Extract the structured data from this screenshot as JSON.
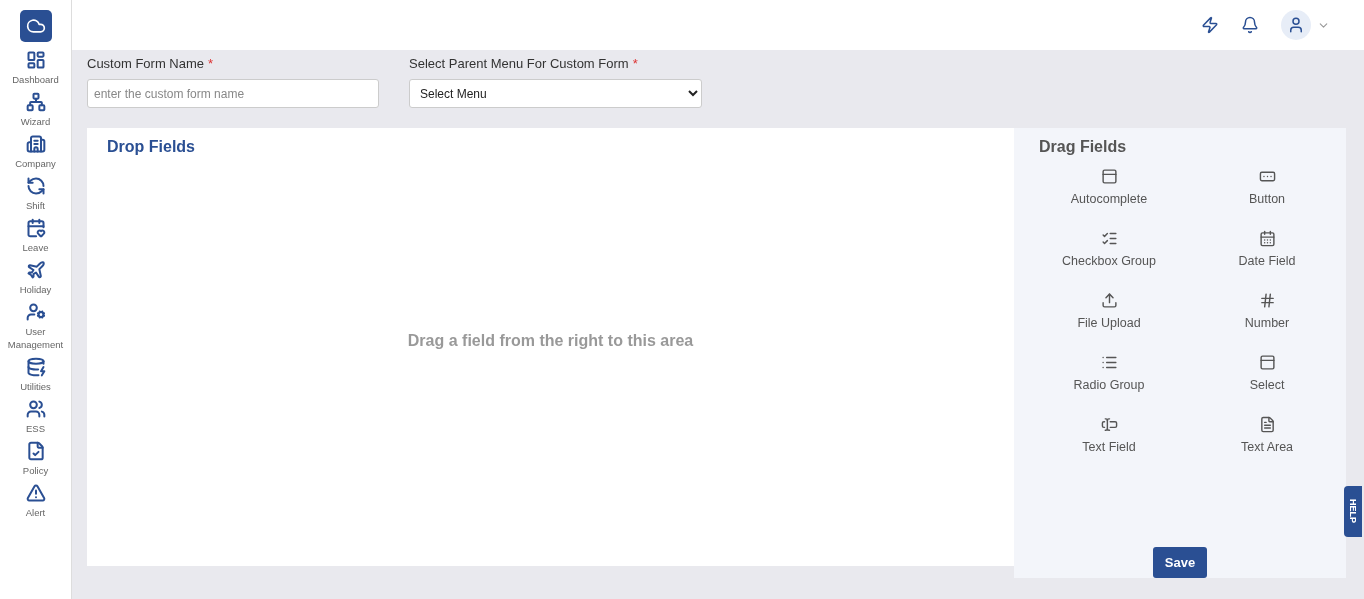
{
  "sidebar": {
    "items": [
      {
        "kind": "dashboard",
        "label": "Dashboard"
      },
      {
        "kind": "wizard",
        "label": "Wizard"
      },
      {
        "kind": "company",
        "label": "Company"
      },
      {
        "kind": "shift",
        "label": "Shift"
      },
      {
        "kind": "leave",
        "label": "Leave"
      },
      {
        "kind": "holiday",
        "label": "Holiday"
      },
      {
        "kind": "user",
        "label": "User Management"
      },
      {
        "kind": "utilities",
        "label": "Utilities"
      },
      {
        "kind": "ess",
        "label": "ESS"
      },
      {
        "kind": "policy",
        "label": "Policy"
      },
      {
        "kind": "alert",
        "label": "Alert"
      }
    ]
  },
  "form": {
    "name_label": "Custom Form Name",
    "name_required": "*",
    "name_placeholder": "enter the custom form name",
    "menu_label": "Select Parent Menu For Custom Form",
    "menu_required": "*",
    "menu_value": "Select Menu"
  },
  "drop_area": {
    "title": "Drop Fields",
    "hint": "Drag a field from the right to this area"
  },
  "drag_area": {
    "title": "Drag Fields",
    "fields": [
      {
        "kind": "autocomplete",
        "label": "Autocomplete"
      },
      {
        "kind": "button",
        "label": "Button"
      },
      {
        "kind": "checkbox",
        "label": "Checkbox Group"
      },
      {
        "kind": "date",
        "label": "Date Field"
      },
      {
        "kind": "upload",
        "label": "File Upload"
      },
      {
        "kind": "number",
        "label": "Number"
      },
      {
        "kind": "radio",
        "label": "Radio Group"
      },
      {
        "kind": "select",
        "label": "Select"
      },
      {
        "kind": "textfield",
        "label": "Text Field"
      },
      {
        "kind": "textarea",
        "label": "Text Area"
      }
    ]
  },
  "save_button": "Save",
  "help_tab": "HELP"
}
